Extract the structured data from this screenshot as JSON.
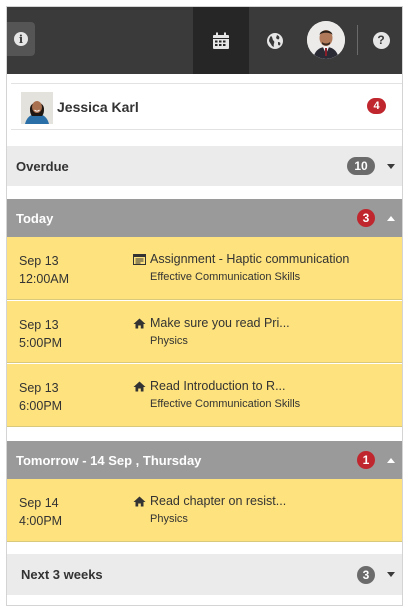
{
  "colors": {
    "topbar": "#3a3a3a",
    "active_tab": "#262626",
    "badge_red": "#c0262e",
    "badge_gray": "#6b6b6b",
    "event_bg": "#fde27e",
    "section_dark": "#9a9a9a",
    "section_light": "#ebebeb"
  },
  "topbar": {
    "icons": [
      "info-icon",
      "calendar-icon",
      "globe-icon",
      "avatar",
      "help-icon"
    ]
  },
  "user": {
    "name": "Jessica Karl",
    "badge": "4"
  },
  "sections": {
    "overdue": {
      "title": "Overdue",
      "count": "10",
      "state": "collapsed"
    },
    "today": {
      "title": "Today",
      "count": "3",
      "state": "expanded"
    },
    "tomorrow": {
      "title": "Tomorrow - 14 Sep , Thursday",
      "count": "1",
      "state": "expanded"
    },
    "next3": {
      "title": "Next 3 weeks",
      "count": "3",
      "state": "collapsed"
    }
  },
  "events": [
    {
      "date": "Sep 13",
      "time": "12:00AM",
      "icon": "assignment-icon",
      "title": "Assignment - Haptic communication",
      "course": "Effective Communication Skills"
    },
    {
      "date": "Sep 13",
      "time": "5:00PM",
      "icon": "home-icon",
      "title": "Make sure you read Pri...",
      "course": "Physics"
    },
    {
      "date": "Sep 13",
      "time": "6:00PM",
      "icon": "home-icon",
      "title": "Read Introduction to R...",
      "course": "Effective Communication Skills"
    },
    {
      "date": "Sep 14",
      "time": "4:00PM",
      "icon": "home-icon",
      "title": "Read chapter on resist...",
      "course": "Physics"
    }
  ]
}
